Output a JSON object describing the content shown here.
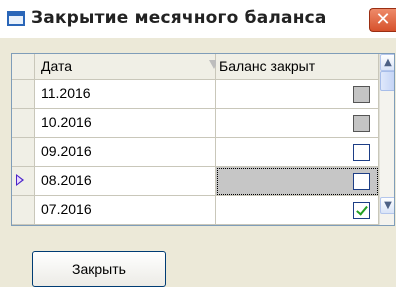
{
  "window": {
    "title": "Закрытие месячного баланса",
    "close_glyph": "✕"
  },
  "grid": {
    "columns": [
      {
        "label": "Дата"
      },
      {
        "label": "Баланс закрыт"
      }
    ],
    "rows": [
      {
        "date": "11.2016",
        "closed": "gray",
        "selected": false
      },
      {
        "date": "10.2016",
        "closed": "gray",
        "selected": false
      },
      {
        "date": "09.2016",
        "closed": "unchecked",
        "selected": false
      },
      {
        "date": "08.2016",
        "closed": "unchecked",
        "selected": true
      },
      {
        "date": "07.2016",
        "closed": "checked",
        "selected": false
      }
    ]
  },
  "scrollbar": {
    "up_glyph": "▲",
    "down_glyph": "▼"
  },
  "buttons": {
    "close_label": "Закрыть"
  },
  "icons": {
    "title_icon": "window-icon",
    "sort_icon": "sort-triangle-icon",
    "row_pointer": "current-row-pointer-icon"
  }
}
